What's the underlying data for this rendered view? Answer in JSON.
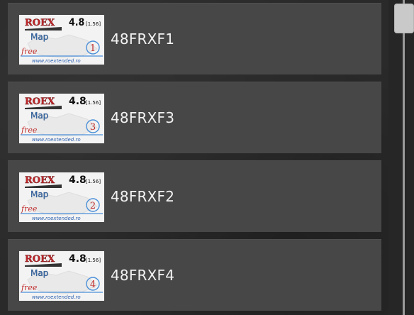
{
  "mods": [
    {
      "name": "48FRXF1",
      "badge": {
        "brand": "ROEX",
        "sub": "Map",
        "version": "4.8",
        "game_version": "[1.56]",
        "tag": "free",
        "number": "1",
        "site": "www.roextended.ro"
      }
    },
    {
      "name": "48FRXF3",
      "badge": {
        "brand": "ROEX",
        "sub": "Map",
        "version": "4.8",
        "game_version": "[1.56]",
        "tag": "free",
        "number": "3",
        "site": "www.roextended.ro"
      }
    },
    {
      "name": "48FRXF2",
      "badge": {
        "brand": "ROEX",
        "sub": "Map",
        "version": "4.8",
        "game_version": "[1.56]",
        "tag": "free",
        "number": "2",
        "site": "www.roextended.ro"
      }
    },
    {
      "name": "48FRXF4",
      "badge": {
        "brand": "ROEX",
        "sub": "Map",
        "version": "4.8",
        "game_version": "[1.56]",
        "tag": "free",
        "number": "4",
        "site": "www.roextended.ro"
      }
    }
  ],
  "colors": {
    "brand_red": "#c0282c",
    "brand_blue": "#3a6fb0",
    "underline_blue": "#4a8fd8",
    "tag_red": "#c23030",
    "item_bg": "#474747",
    "page_bg": "#2a2a2a"
  }
}
